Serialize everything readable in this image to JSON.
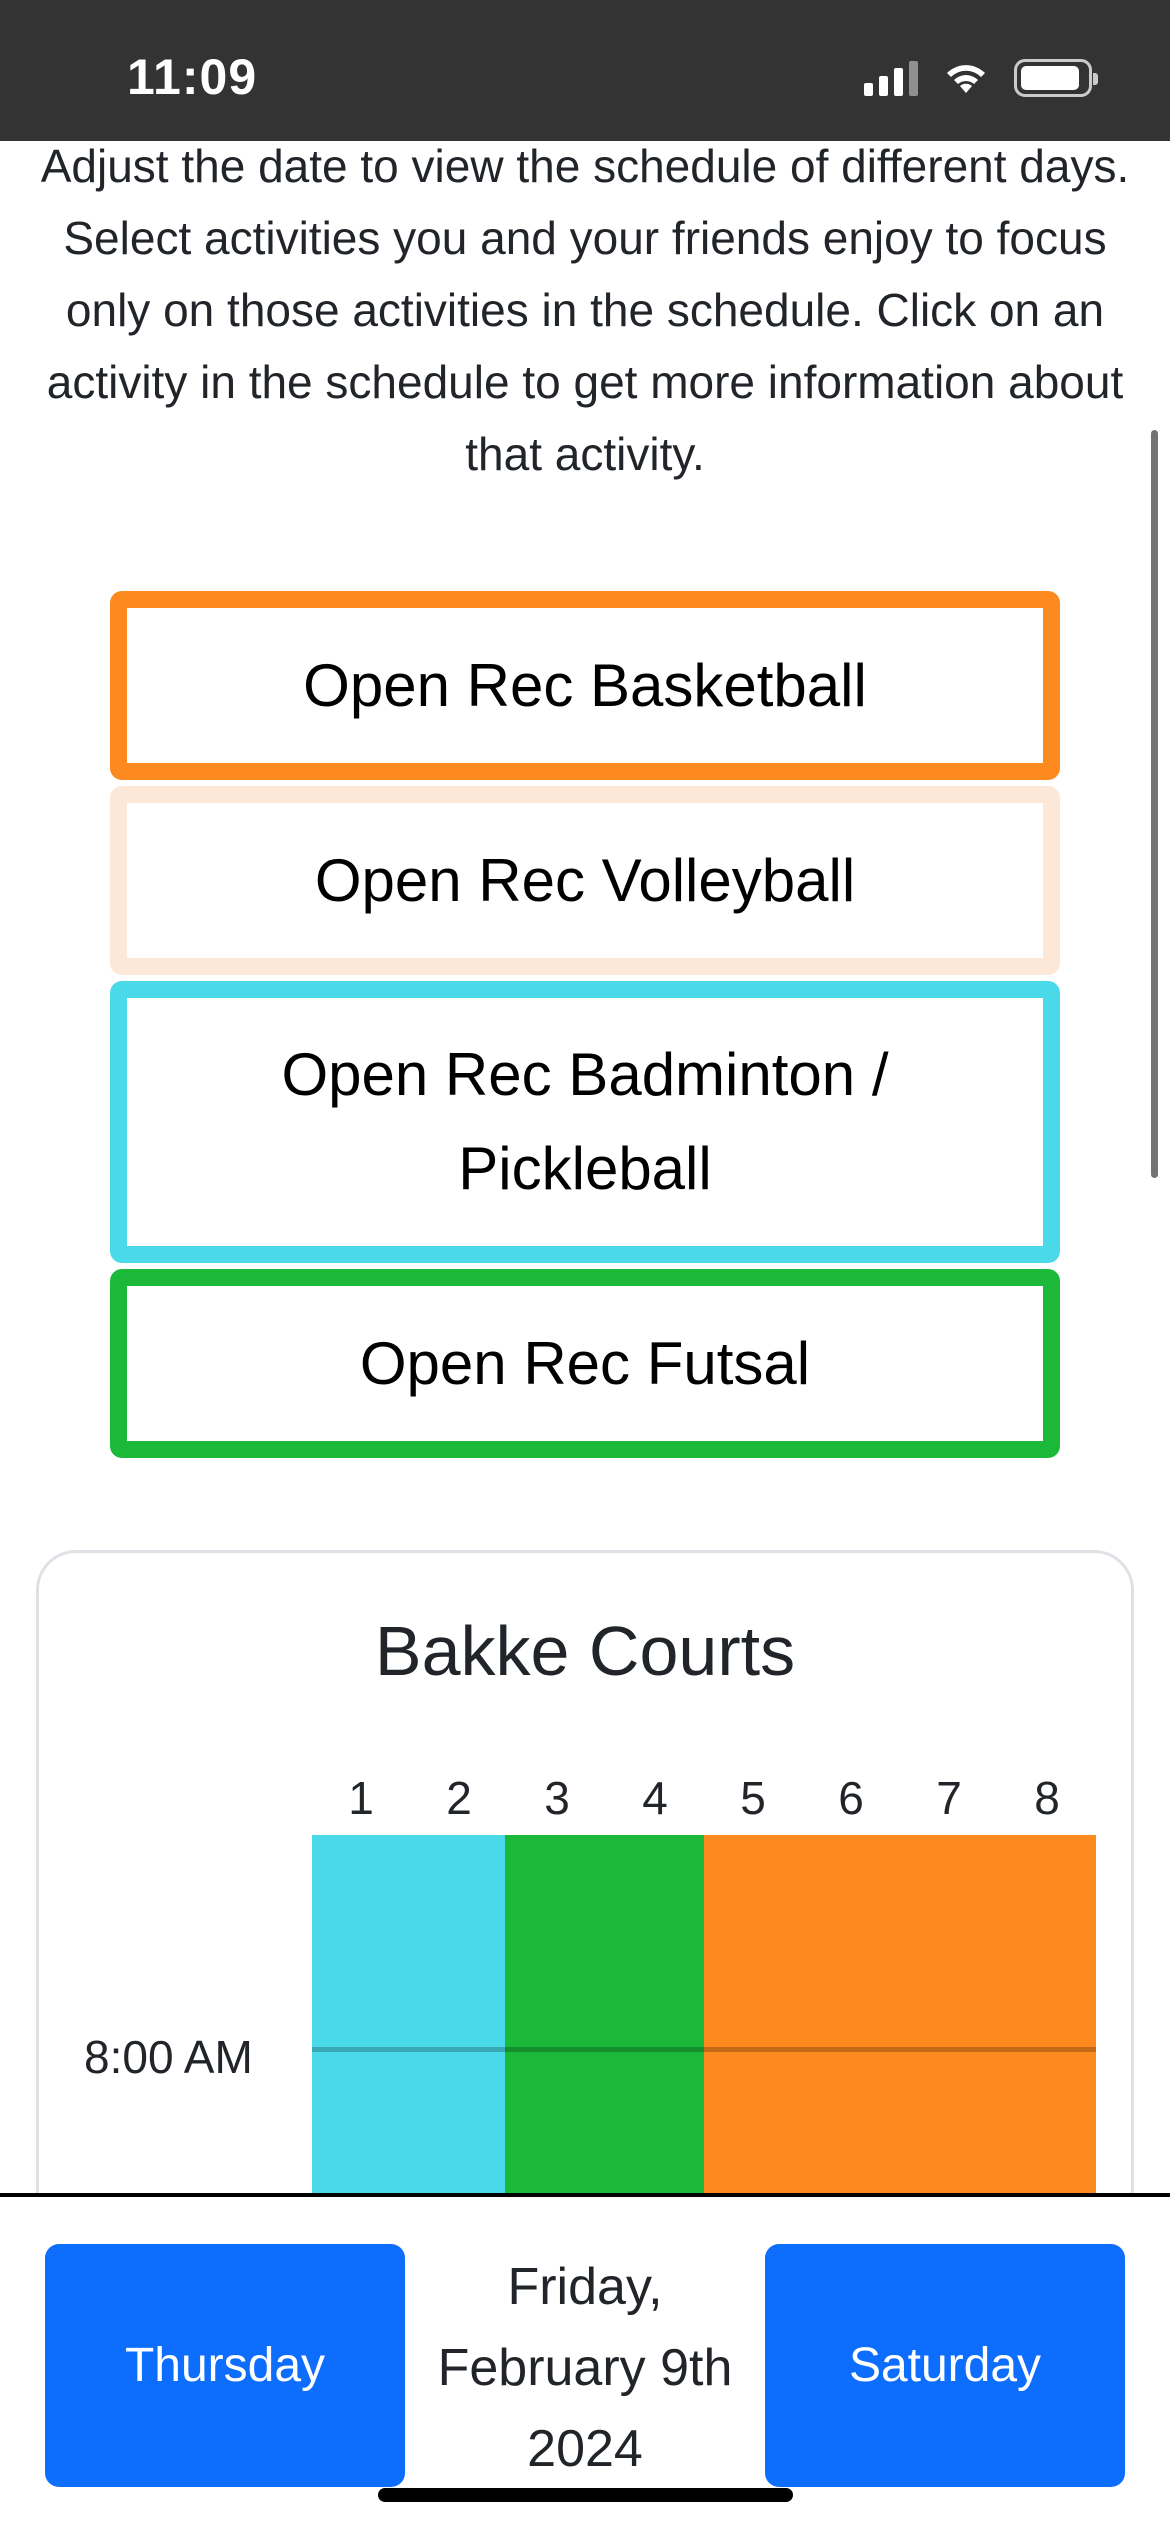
{
  "status_bar": {
    "time": "11:09"
  },
  "intro": {
    "text": "Adjust the date to view the schedule of different days. Select activities you and your friends enjoy to focus only on those activities in the schedule. Click on an activity in the schedule to get more information about that activity."
  },
  "activities": [
    {
      "label": "Open Rec Basketball",
      "color": "#fd8a1e"
    },
    {
      "label": "Open Rec Volleyball",
      "color": "#fde8d8"
    },
    {
      "label": "Open Rec Badminton / Pickleball",
      "color": "#49d9e8"
    },
    {
      "label": "Open Rec Futsal",
      "color": "#1cb83a"
    }
  ],
  "schedule": {
    "facility": "Bakke Courts",
    "courts": [
      "1",
      "2",
      "3",
      "4",
      "5",
      "6",
      "7",
      "8"
    ],
    "times": [
      "8:00 AM"
    ],
    "blocks": [
      {
        "activity": "Open Rec Badminton / Pickleball",
        "courts": [
          "1",
          "2"
        ]
      },
      {
        "activity": "Open Rec Futsal",
        "courts": [
          "3",
          "4"
        ]
      },
      {
        "activity": "Open Rec Basketball",
        "courts": [
          "5",
          "6",
          "7",
          "8"
        ]
      }
    ]
  },
  "navigation": {
    "prev_label": "Thursday",
    "next_label": "Saturday",
    "current_day": "Friday,",
    "current_month_day": "February 9th",
    "current_year": "2024"
  },
  "colors": {
    "primary_button": "#0d6efd",
    "status_bar": "#333333"
  }
}
